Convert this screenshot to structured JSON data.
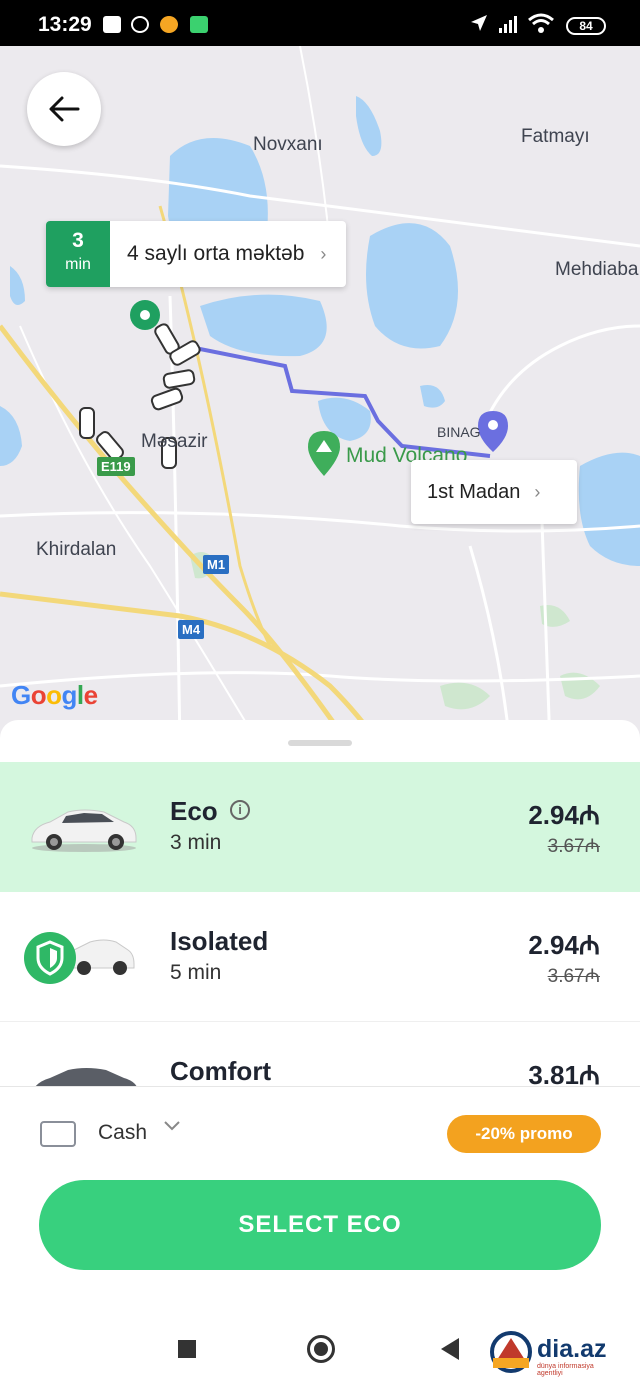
{
  "status_bar": {
    "time": "13:29",
    "battery": "84",
    "icons": [
      "message-icon",
      "whatsapp-icon",
      "game-icon",
      "app-icon",
      "navigation-icon",
      "signal-icon",
      "wifi-icon",
      "battery-icon"
    ]
  },
  "map": {
    "labels": {
      "novxani": "Novxanı",
      "fatmayi": "Fatmayı",
      "mehdiabad": "Mehdiaba",
      "mehdiabad_full_hidden": "",
      "masazir": "Məsazir",
      "binagadi": "BINAG",
      "mud_volcano": "Mud Volcano",
      "khirdalan": "Khirdalan"
    },
    "road_shields": {
      "e119": "E119",
      "m1": "M1",
      "m4": "M4"
    },
    "pickup": {
      "eta_number": "3",
      "eta_unit": "min",
      "address": "4 saylı orta məktəb"
    },
    "destination": {
      "address": "1st Madan"
    },
    "attribution": "Google",
    "colors": {
      "water": "#a9d2f5",
      "route": "#6b6fe0",
      "pickup_pin": "#1fa060",
      "dest_pin": "#6b6fe0"
    }
  },
  "options": [
    {
      "name": "Eco",
      "eta": "3 min",
      "price": "2.94₼",
      "old_price": "3.67₼",
      "selected": true,
      "info": "i"
    },
    {
      "name": "Isolated",
      "eta": "5 min",
      "price": "2.94₼",
      "old_price": "3.67₼",
      "selected": false
    },
    {
      "name": "Comfort",
      "eta": "",
      "price": "3.81₼",
      "old_price": "",
      "selected": false
    }
  ],
  "payment": {
    "method": "Cash",
    "promo": "-20% promo"
  },
  "action": {
    "label": "SELECT ECO"
  },
  "watermark": {
    "brand": "dia.az",
    "tagline": "dünya informasiya agentliyi"
  },
  "accent": "#38d07e"
}
